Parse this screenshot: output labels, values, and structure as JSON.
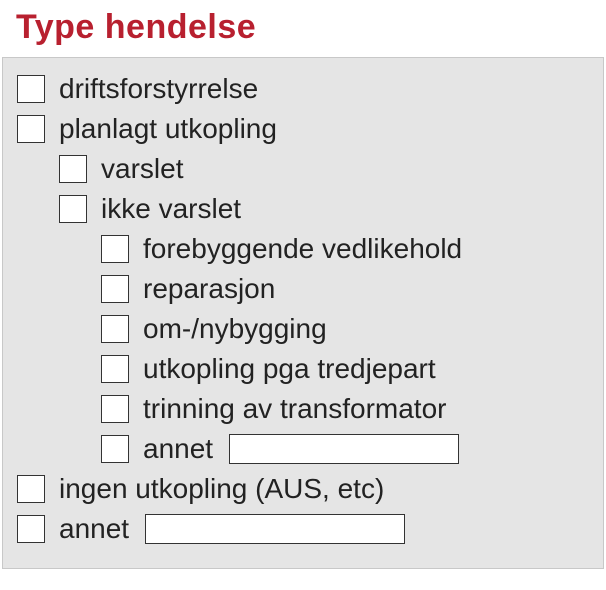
{
  "heading": "Type hendelse",
  "items": {
    "driftsforstyrrelse": "driftsforstyrrelse",
    "planlagt_utkopling": "planlagt utkopling",
    "varslet": "varslet",
    "ikke_varslet": "ikke varslet",
    "forebyggende_vedlikehold": "forebyggende vedlikehold",
    "reparasjon": "reparasjon",
    "om_nybygging": "om-/nybygging",
    "utkopling_pga_tredjepart": "utkopling pga tredjepart",
    "trinning_av_transformator": "trinning av transformator",
    "annet_sub": "annet",
    "ingen_utkopling": "ingen utkopling (AUS, etc)",
    "annet": "annet"
  },
  "inputs": {
    "annet_sub_value": "",
    "annet_value": ""
  }
}
